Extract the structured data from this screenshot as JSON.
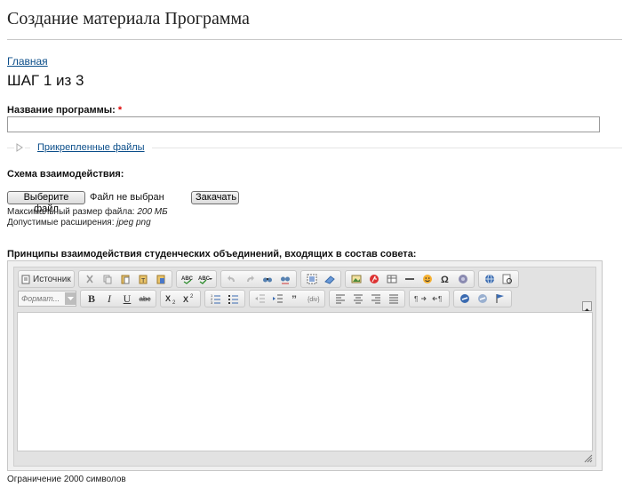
{
  "page": {
    "title": "Создание материала Программа",
    "breadcrumb": "Главная",
    "step": "ШАГ 1 из 3"
  },
  "program_name": {
    "label": "Название программы:",
    "required_mark": "*",
    "value": ""
  },
  "attachments": {
    "link": "Прикрепленные файлы"
  },
  "schema": {
    "label": "Схема взаимодействия:",
    "choose_button": "Выберите файл",
    "file_status": "Файл не выбран",
    "upload_button": "Закачать",
    "max_size_label": "Максимальный размер файла:",
    "max_size_value": "200 МБ",
    "extensions_label": "Допустимые расширения:",
    "extensions_value": "jpeg png"
  },
  "principles": {
    "label": "Принципы взаимодействия студенческих объединений, входящих в состав совета:"
  },
  "editor": {
    "source_label": "Источник",
    "format_placeholder": "Формат...",
    "colors": {
      "toolbar_bg": "#e3e3e3",
      "link": "#0b4e8a",
      "required": "#dd0000"
    }
  },
  "footer": {
    "limit_note": "Ограничение 2000 символов"
  }
}
